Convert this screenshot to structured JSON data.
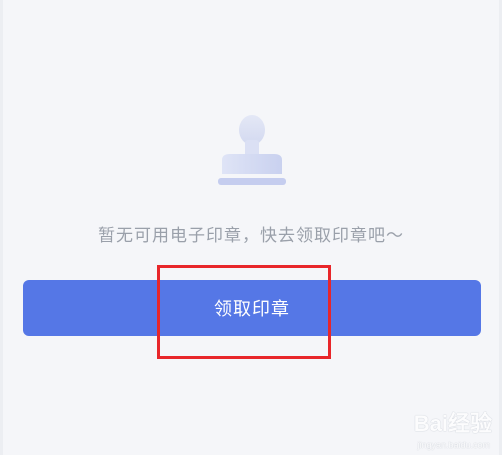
{
  "empty_state": {
    "message": "暂无可用电子印章，快去领取印章吧～",
    "icon": "stamp-icon"
  },
  "actions": {
    "claim_label": "领取印章"
  },
  "watermark": {
    "brand": "Bai经验",
    "site": "jingyan.baidu.com"
  },
  "colors": {
    "background": "#f5f6f9",
    "button": "#5577e6",
    "highlight": "#e8262a",
    "text_muted": "#9aa0aa"
  }
}
